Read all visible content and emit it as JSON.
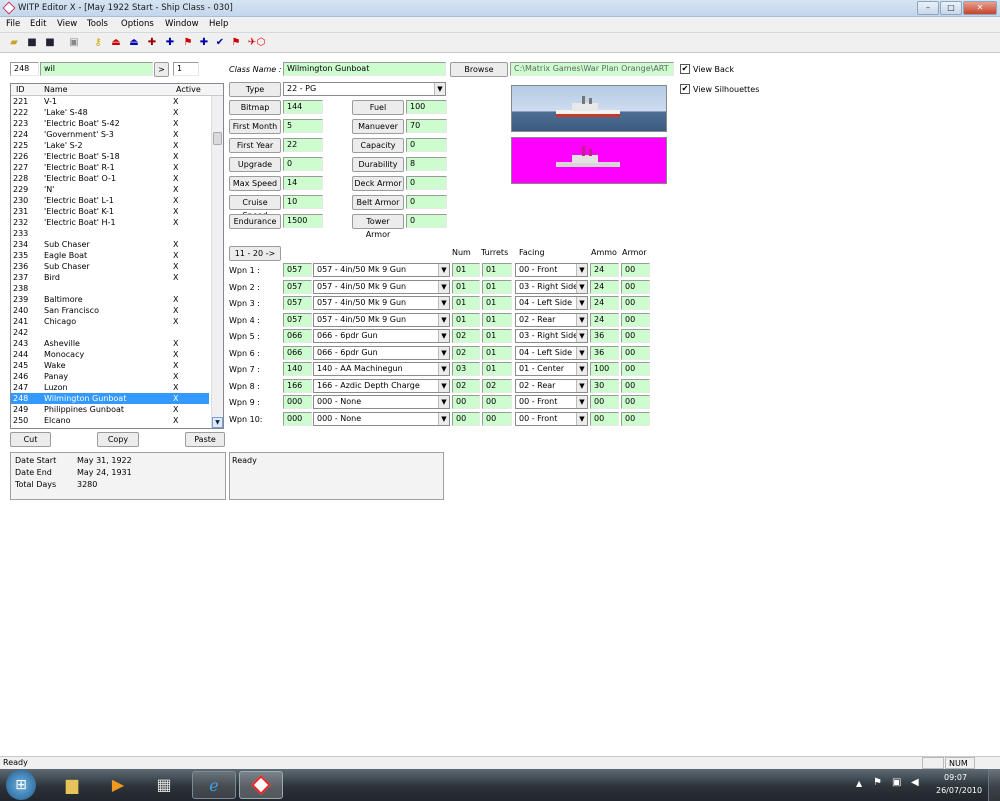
{
  "window": {
    "title": "WITP Editor X - [May 1922 Start - Ship Class - 030]",
    "min": "–",
    "max": "□",
    "close": "✕"
  },
  "menu": [
    "File",
    "Edit",
    "View",
    "Tools",
    "Options",
    "Window",
    "Help"
  ],
  "search": {
    "id": "248",
    "text": "wil",
    "go": ">",
    "count": "1"
  },
  "list": {
    "headers": [
      "ID",
      "Name",
      "Active"
    ],
    "rows": [
      [
        "221",
        "V-1",
        "X"
      ],
      [
        "222",
        "'Lake' S-48",
        "X"
      ],
      [
        "223",
        "'Electric Boat' S-42",
        "X"
      ],
      [
        "224",
        "'Government' S-3",
        "X"
      ],
      [
        "225",
        "'Lake' S-2",
        "X"
      ],
      [
        "226",
        "'Electric Boat' S-18",
        "X"
      ],
      [
        "227",
        "'Electric Boat' R-1",
        "X"
      ],
      [
        "228",
        "'Electric Boat' O-1",
        "X"
      ],
      [
        "229",
        "'N'",
        "X"
      ],
      [
        "230",
        "'Electric Boat' L-1",
        "X"
      ],
      [
        "231",
        "'Electric Boat' K-1",
        "X"
      ],
      [
        "232",
        "'Electric Boat' H-1",
        "X"
      ],
      [
        "233",
        "",
        ""
      ],
      [
        "234",
        "Sub Chaser",
        "X"
      ],
      [
        "235",
        "Eagle Boat",
        "X"
      ],
      [
        "236",
        "Sub Chaser",
        "X"
      ],
      [
        "237",
        "Bird",
        "X"
      ],
      [
        "238",
        "",
        ""
      ],
      [
        "239",
        "Baltimore",
        "X"
      ],
      [
        "240",
        "San Francisco",
        "X"
      ],
      [
        "241",
        "Chicago",
        "X"
      ],
      [
        "242",
        "",
        ""
      ],
      [
        "243",
        "Asheville",
        "X"
      ],
      [
        "244",
        "Monocacy",
        "X"
      ],
      [
        "245",
        "Wake",
        "X"
      ],
      [
        "246",
        "Panay",
        "X"
      ],
      [
        "247",
        "Luzon",
        "X"
      ],
      [
        "248",
        "Wilmington Gunboat",
        "X"
      ],
      [
        "249",
        "Philippines Gunboat",
        "X"
      ],
      [
        "250",
        "Elcano",
        "X"
      ]
    ],
    "selected_index": 27
  },
  "edit_buttons": {
    "cut": "Cut",
    "copy": "Copy",
    "paste": "Paste"
  },
  "info": {
    "date_start_label": "Date Start",
    "date_start": "May 31, 1922",
    "date_end_label": "Date End",
    "date_end": "May 24, 1931",
    "total_days_label": "Total Days",
    "total_days": "3280"
  },
  "status_text": "Ready",
  "class": {
    "name_label": "Class Name :",
    "name": "Wilmington Gunboat",
    "browse": "Browse",
    "path": "C:\\Matrix Games\\War Plan Orange\\ART",
    "view_back": "View Back",
    "view_silhouettes": "View Silhouettes",
    "type_label": "Type",
    "type_value": "22 -  PG"
  },
  "stats_left": [
    {
      "label": "Bitmap",
      "value": "144"
    },
    {
      "label": "First Month",
      "value": "5"
    },
    {
      "label": "First Year",
      "value": "22"
    },
    {
      "label": "Upgrade",
      "value": "0"
    },
    {
      "label": "Max Speed",
      "value": "14"
    },
    {
      "label": "Cruise Speed",
      "value": "10"
    },
    {
      "label": "Endurance",
      "value": "1500"
    }
  ],
  "stats_right": [
    {
      "label": "Fuel",
      "value": "100"
    },
    {
      "label": "Manuever",
      "value": "70"
    },
    {
      "label": "Capacity",
      "value": "0"
    },
    {
      "label": "Durability",
      "value": "8"
    },
    {
      "label": "Deck Armor",
      "value": "0"
    },
    {
      "label": "Belt Armor",
      "value": "0"
    },
    {
      "label": "Tower Armor",
      "value": "0"
    }
  ],
  "weapons": {
    "page_button": "11 - 20 ->",
    "headers": {
      "num": "Num",
      "turrets": "Turrets",
      "facing": "Facing",
      "ammo": "Ammo",
      "armor": "Armor"
    },
    "rows": [
      {
        "label": "Wpn 1 :",
        "code": "057",
        "name": "057 - 4in/50 Mk 9 Gun",
        "num": "01",
        "turrets": "01",
        "facing": "00 - Front",
        "ammo": "24",
        "armor": "00"
      },
      {
        "label": "Wpn 2 :",
        "code": "057",
        "name": "057 - 4in/50 Mk 9 Gun",
        "num": "01",
        "turrets": "01",
        "facing": "03 - Right Side",
        "ammo": "24",
        "armor": "00"
      },
      {
        "label": "Wpn 3 :",
        "code": "057",
        "name": "057 - 4in/50 Mk 9 Gun",
        "num": "01",
        "turrets": "01",
        "facing": "04 - Left Side",
        "ammo": "24",
        "armor": "00"
      },
      {
        "label": "Wpn 4 :",
        "code": "057",
        "name": "057 - 4in/50 Mk 9 Gun",
        "num": "01",
        "turrets": "01",
        "facing": "02 - Rear",
        "ammo": "24",
        "armor": "00"
      },
      {
        "label": "Wpn 5 :",
        "code": "066",
        "name": "066 - 6pdr Gun",
        "num": "02",
        "turrets": "01",
        "facing": "03 - Right Side",
        "ammo": "36",
        "armor": "00"
      },
      {
        "label": "Wpn 6 :",
        "code": "066",
        "name": "066 - 6pdr Gun",
        "num": "02",
        "turrets": "01",
        "facing": "04 - Left Side",
        "ammo": "36",
        "armor": "00"
      },
      {
        "label": "Wpn 7 :",
        "code": "140",
        "name": "140 - AA Machinegun",
        "num": "03",
        "turrets": "01",
        "facing": "01 - Center",
        "ammo": "100",
        "armor": "00"
      },
      {
        "label": "Wpn 8 :",
        "code": "166",
        "name": "166 - Azdic Depth Charge",
        "num": "02",
        "turrets": "02",
        "facing": "02 - Rear",
        "ammo": "30",
        "armor": "00"
      },
      {
        "label": "Wpn 9 :",
        "code": "000",
        "name": "000 - None",
        "num": "00",
        "turrets": "00",
        "facing": "00 - Front",
        "ammo": "00",
        "armor": "00"
      },
      {
        "label": "Wpn 10:",
        "code": "000",
        "name": "000 - None",
        "num": "00",
        "turrets": "00",
        "facing": "00 - Front",
        "ammo": "00",
        "armor": "00"
      }
    ]
  },
  "statusbar": {
    "text": "Ready",
    "num": "NUM"
  },
  "clock": {
    "time": "09:07",
    "date": "26/07/2010"
  },
  "colors": {
    "field_green": "#cdfccf",
    "selection": "#3399ff",
    "silhouette_bg": "#ff00ff"
  },
  "icons": [
    "open-icon",
    "save-icon",
    "save-all-icon",
    "print-icon",
    "key-icon",
    "ship-icon",
    "sub-icon",
    "destroyer-icon",
    "cross-icon",
    "flag-icon",
    "plus-icon",
    "check-icon",
    "aircraft-icon",
    "network-icon",
    "hexagon-icon"
  ]
}
